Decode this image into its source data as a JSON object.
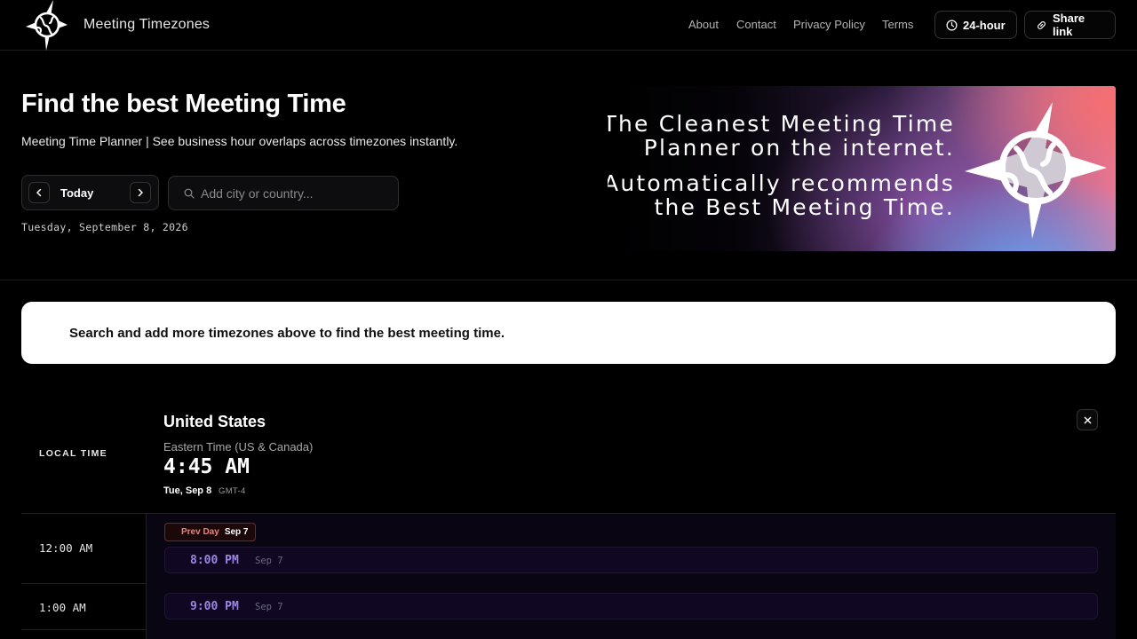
{
  "header": {
    "brand": "Meeting Timezones",
    "nav": {
      "about": "About",
      "contact": "Contact",
      "privacy": "Privacy Policy",
      "terms": "Terms"
    },
    "format_button": "24-hour",
    "share_button": "Share link"
  },
  "hero": {
    "title": "Find the best Meeting Time",
    "subtitle": "Meeting Time Planner | See business hour overlaps across timezones instantly.",
    "today_label": "Today",
    "search_placeholder": "Add city or country...",
    "full_date": "Tuesday, September 8, 2026"
  },
  "banner": {
    "line1": "The Cleanest Meeting Time",
    "line2": "Planner on the internet.",
    "line3": "Automatically recommends",
    "line4": "the Best Meeting Time."
  },
  "notice": "Search and add more timezones above to find the best meeting time.",
  "timezone": {
    "local_label": "LOCAL TIME",
    "country": "United States",
    "zone_name": "Eastern Time (US & Canada)",
    "current_time": "4:45 AM",
    "day": "Tue, Sep 8",
    "offset": "GMT-4",
    "prev_day_label": "Prev Day",
    "prev_day_date": "Sep 7",
    "rows": [
      {
        "local": "12:00 AM",
        "time": "8:00 PM",
        "date": "Sep 7"
      },
      {
        "local": "1:00 AM",
        "time": "9:00 PM",
        "date": "Sep 7"
      }
    ]
  },
  "colors": {
    "accent_purple": "#9d86e8",
    "prev_day_red": "#f08080",
    "background": "#000000"
  }
}
